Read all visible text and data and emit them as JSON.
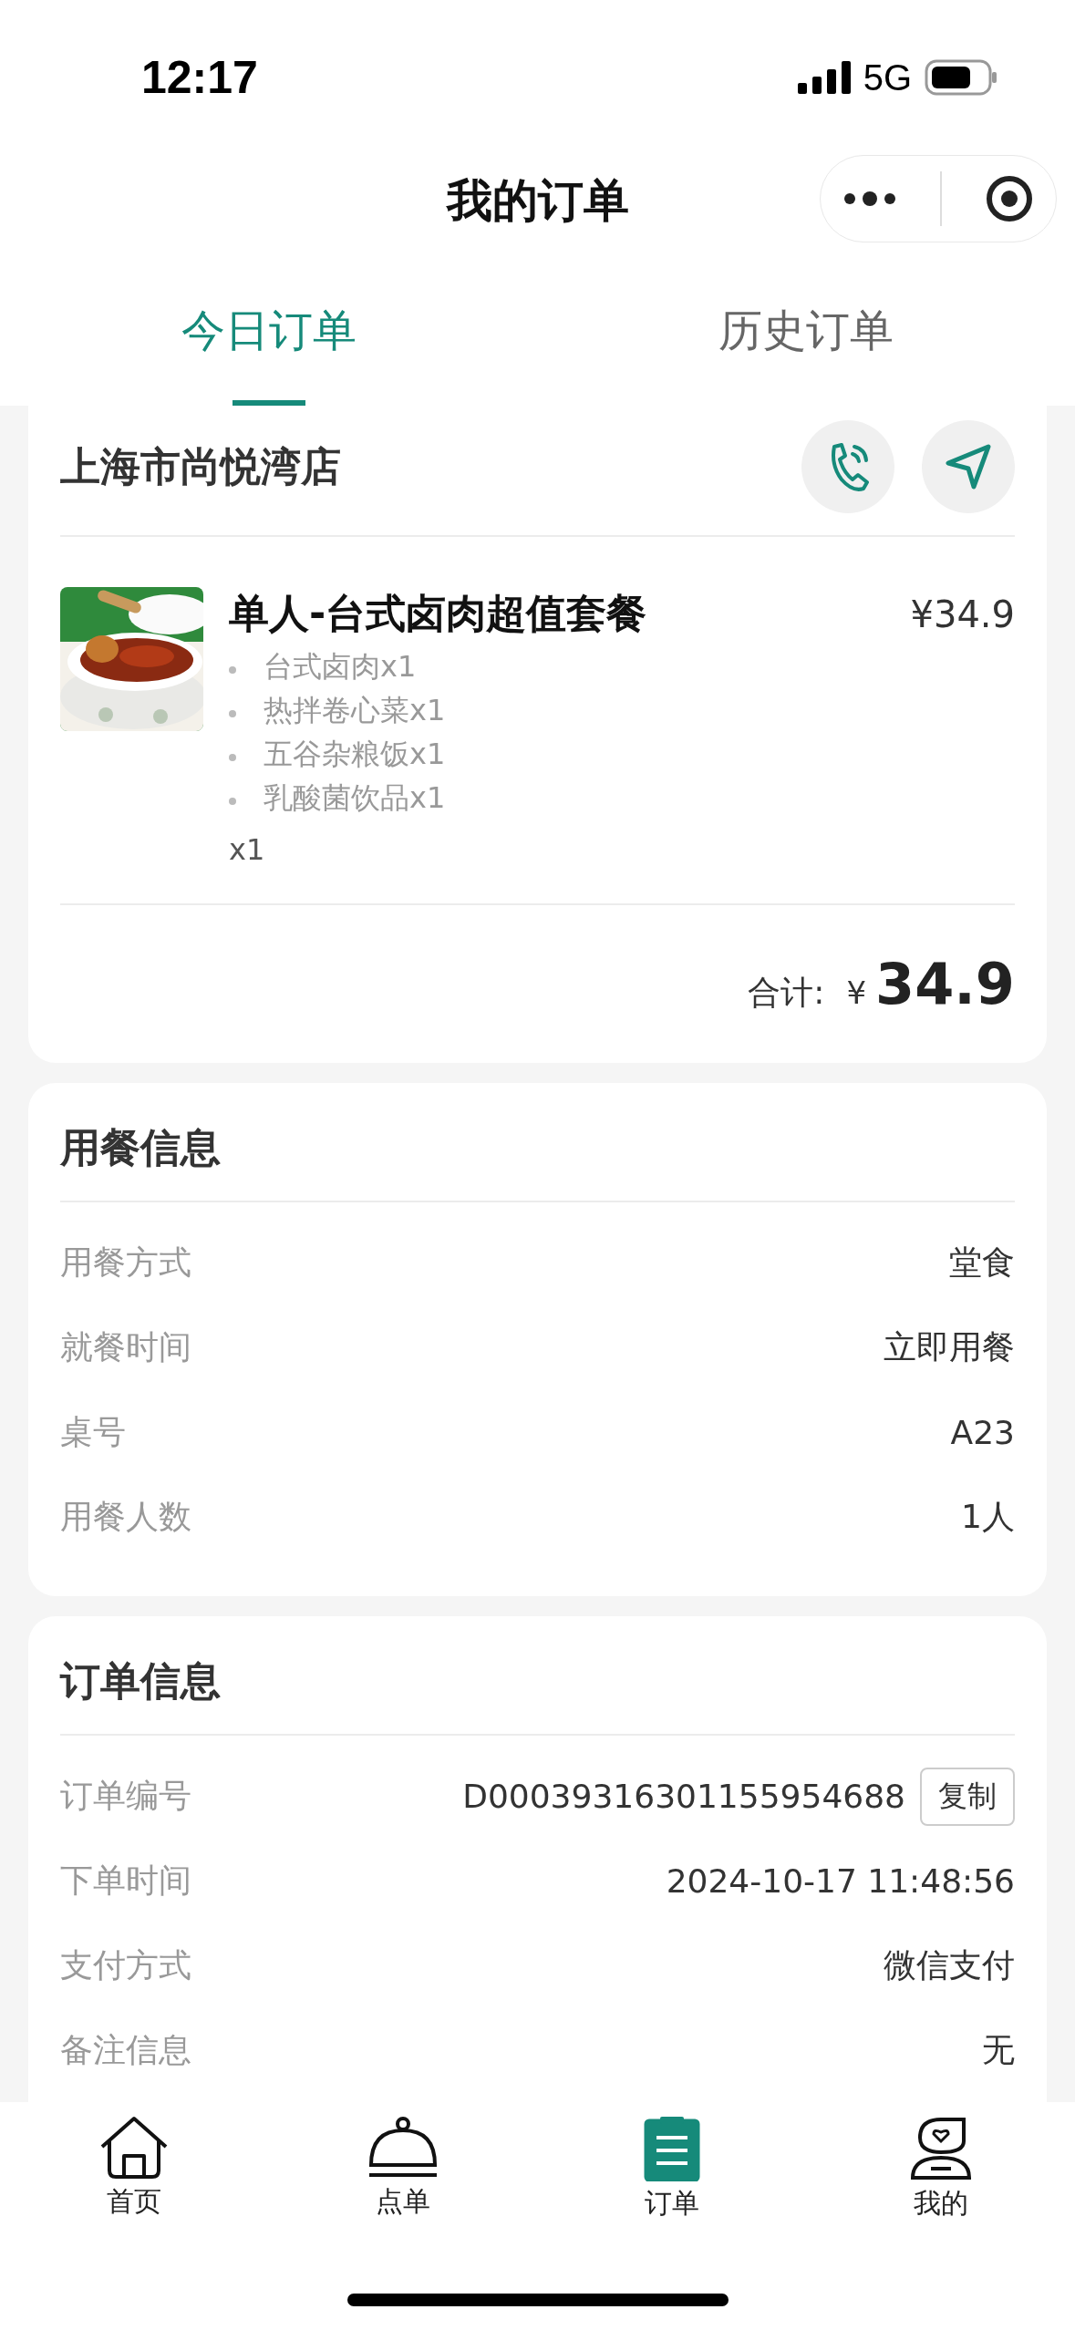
{
  "status_bar": {
    "time": "12:17",
    "network": "5G"
  },
  "nav": {
    "title": "我的订单"
  },
  "tabs": [
    {
      "label": "今日订单",
      "selected": true
    },
    {
      "label": "历史订单",
      "selected": false
    }
  ],
  "store": {
    "name": "上海市尚悦湾店"
  },
  "order_item": {
    "name": "单人-台式卤肉超值套餐",
    "price": "¥34.9",
    "components": [
      "台式卤肉x1",
      "热拌卷心菜x1",
      "五谷杂粮饭x1",
      "乳酸菌饮品x1"
    ],
    "quantity": "x1"
  },
  "total": {
    "label": "合计:",
    "currency": "¥",
    "amount": "34.9"
  },
  "sections": [
    {
      "title": "用餐信息",
      "rows": [
        {
          "label": "用餐方式",
          "value": "堂食"
        },
        {
          "label": "就餐时间",
          "value": "立即用餐"
        },
        {
          "label": "桌号",
          "value": "A23"
        },
        {
          "label": "用餐人数",
          "value": "1人"
        }
      ]
    },
    {
      "title": "订单信息",
      "rows": [
        {
          "label": "订单编号",
          "value": "D00039316301155954688",
          "action": "复制"
        },
        {
          "label": "下单时间",
          "value": "2024-10-17 11:48:56"
        },
        {
          "label": "支付方式",
          "value": "微信支付"
        },
        {
          "label": "备注信息",
          "value": "无"
        }
      ]
    }
  ],
  "tab_bar": [
    {
      "label": "首页",
      "kind": "home",
      "selected": false
    },
    {
      "label": "点单",
      "kind": "cloche",
      "selected": false
    },
    {
      "label": "订单",
      "kind": "clipboard",
      "selected": true
    },
    {
      "label": "我的",
      "kind": "profile",
      "selected": false
    }
  ]
}
